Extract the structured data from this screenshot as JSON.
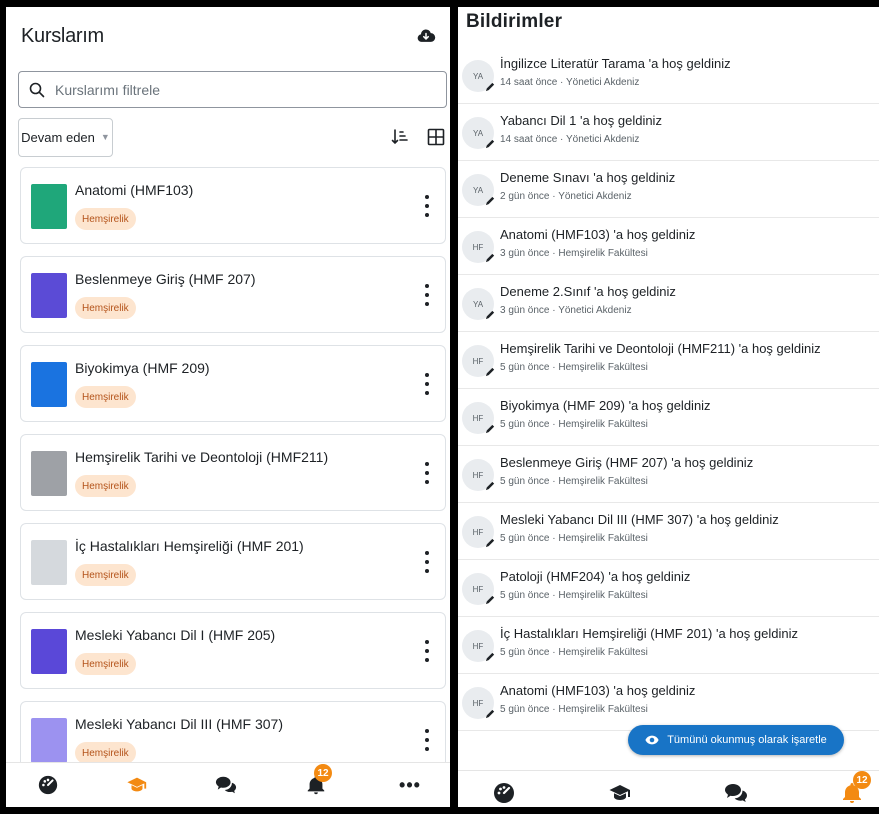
{
  "left": {
    "title": "Kurslarım",
    "search_placeholder": "Kurslarımı filtrele",
    "filter_label": "Devam eden",
    "courses": [
      {
        "name": "Anatomi (HMF103)",
        "category": "Hemşirelik",
        "color": "#1fa77a"
      },
      {
        "name": "Beslenmeye Giriş (HMF 207)",
        "category": "Hemşirelik",
        "color": "#5b4bd6"
      },
      {
        "name": "Biyokimya (HMF 209)",
        "category": "Hemşirelik",
        "color": "#1a73e0"
      },
      {
        "name": "Hemşirelik Tarihi ve Deontoloji (HMF211)",
        "category": "Hemşirelik",
        "color": "#9ea1a6"
      },
      {
        "name": "İç Hastalıkları Hemşireliği (HMF 201)",
        "category": "Hemşirelik",
        "color": "#d5d9dd"
      },
      {
        "name": "Mesleki Yabancı Dil I (HMF 205)",
        "category": "Hemşirelik",
        "color": "#5a48d8"
      },
      {
        "name": "Mesleki Yabancı Dil III (HMF 307)",
        "category": "Hemşirelik",
        "color": "#9c92f0"
      }
    ],
    "nav": {
      "notification_count": "12",
      "more_label": "•••"
    }
  },
  "right": {
    "title": "Bildirimler",
    "notifications": [
      {
        "initials": "YA",
        "title": "İngilizce Literatür Tarama 'a hoş geldiniz",
        "meta": "14 saat önce · Yönetici Akdeniz"
      },
      {
        "initials": "YA",
        "title": "Yabancı Dil 1 'a hoş geldiniz",
        "meta": "14 saat önce · Yönetici Akdeniz"
      },
      {
        "initials": "YA",
        "title": "Deneme Sınavı 'a hoş geldiniz",
        "meta": "2 gün önce · Yönetici Akdeniz"
      },
      {
        "initials": "HF",
        "title": "Anatomi (HMF103) 'a hoş geldiniz",
        "meta": "3 gün önce · Hemşirelik Fakültesi"
      },
      {
        "initials": "YA",
        "title": "Deneme 2.Sınıf 'a hoş geldiniz",
        "meta": "3 gün önce · Yönetici Akdeniz"
      },
      {
        "initials": "HF",
        "title": "Hemşirelik Tarihi ve Deontoloji (HMF211) 'a hoş geldiniz",
        "meta": "5 gün önce · Hemşirelik Fakültesi"
      },
      {
        "initials": "HF",
        "title": "Biyokimya (HMF 209) 'a hoş geldiniz",
        "meta": "5 gün önce · Hemşirelik Fakültesi"
      },
      {
        "initials": "HF",
        "title": "Beslenmeye Giriş (HMF 207) 'a hoş geldiniz",
        "meta": "5 gün önce · Hemşirelik Fakültesi"
      },
      {
        "initials": "HF",
        "title": "Mesleki Yabancı Dil III (HMF 307) 'a hoş geldiniz",
        "meta": "5 gün önce · Hemşirelik Fakültesi"
      },
      {
        "initials": "HF",
        "title": "Patoloji (HMF204) 'a hoş geldiniz",
        "meta": "5 gün önce · Hemşirelik Fakültesi"
      },
      {
        "initials": "HF",
        "title": "İç Hastalıkları Hemşireliği (HMF 201) 'a hoş geldiniz",
        "meta": "5 gün önce · Hemşirelik Fakültesi"
      },
      {
        "initials": "HF",
        "title": "Anatomi (HMF103) 'a hoş geldiniz",
        "meta": "5 gün önce · Hemşirelik Fakültesi"
      }
    ],
    "mark_all_label": "Tümünü okunmuş olarak işaretle",
    "nav": {
      "notification_count": "12"
    }
  },
  "colors": {
    "accent": "#f38a12",
    "badge_bg": "#fde5cf",
    "badge_text": "#b4531a",
    "button_blue": "#1874c6"
  }
}
